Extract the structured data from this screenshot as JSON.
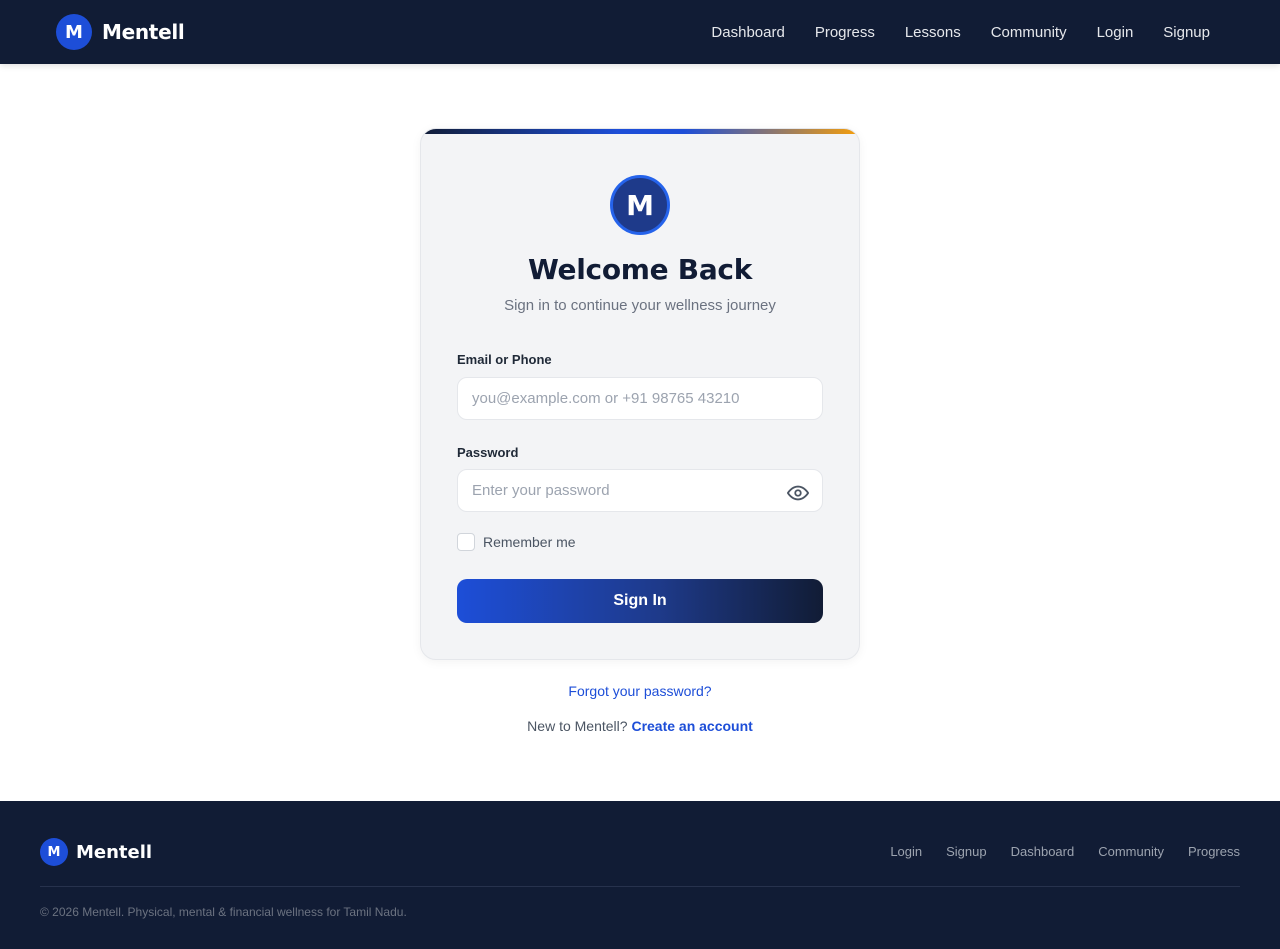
{
  "header": {
    "brand_initial": "M",
    "brand_name": "Mentell",
    "nav": [
      "Dashboard",
      "Progress",
      "Lessons",
      "Community",
      "Login",
      "Signup"
    ]
  },
  "login_card": {
    "logo_initial": "M",
    "title": "Welcome Back",
    "subtitle": "Sign in to continue your wellness journey",
    "email_label": "Email or Phone",
    "email_placeholder": "you@example.com or +91 98765 43210",
    "email_value": "",
    "password_label": "Password",
    "password_placeholder": "Enter your password",
    "password_value": "",
    "remember_label": "Remember me",
    "remember_checked": false,
    "submit_label": "Sign In"
  },
  "links": {
    "forgot": "Forgot your password?",
    "new_prefix": "New to Mentell?",
    "create": "Create an account"
  },
  "footer": {
    "brand_initial": "M",
    "brand_name": "Mentell",
    "links": [
      "Login",
      "Signup",
      "Dashboard",
      "Community",
      "Progress"
    ],
    "copyright": "© 2026 Mentell. Physical, mental & financial wellness for Tamil Nadu."
  },
  "icons": {
    "password_toggle": "eye-icon"
  },
  "colors": {
    "nav_bg": "#111c35",
    "accent": "#1d4ed8",
    "accent_orange": "#f59e0b",
    "card_bg": "#f3f4f6"
  }
}
